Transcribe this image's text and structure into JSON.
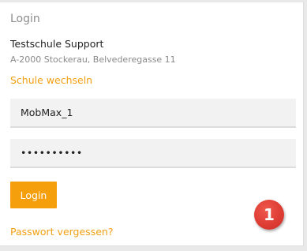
{
  "login": {
    "title": "Login",
    "school_name": "Testschule Support",
    "school_address": "A-2000 Stockerau, Belvederegasse 11",
    "switch_school_link": "Schule wechseln",
    "username_value": "MobMax_1",
    "password_value": "••••••••••",
    "login_button": "Login",
    "forgot_password_link": "Passwort vergessen?"
  },
  "annotation": {
    "step_number": "1"
  },
  "colors": {
    "accent": "#f59f0c",
    "link": "#f0a012",
    "badge": "#dc3b32"
  }
}
